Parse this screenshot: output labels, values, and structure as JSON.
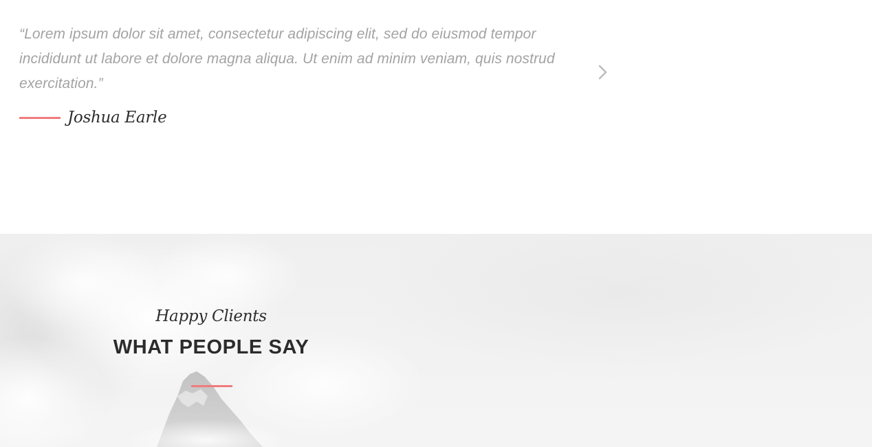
{
  "testimonial": {
    "quote": "“Lorem ipsum dolor sit amet, consectetur adipiscing elit, sed do eiusmod tempor incididunt ut labore et dolore magna aliqua. Ut enim ad minim veniam, quis nostrud exercitation.”",
    "author": "Joshua Earle",
    "next_icon": "chevron-right-icon"
  },
  "clients": {
    "subtitle": "Happy Clients",
    "title": "WHAT PEOPLE SAY"
  },
  "colors": {
    "accent": "#f07c7c",
    "quote_text": "#a3a3a3",
    "heading_text": "#2b2b2b",
    "section_bg": "#f0f0f0"
  }
}
